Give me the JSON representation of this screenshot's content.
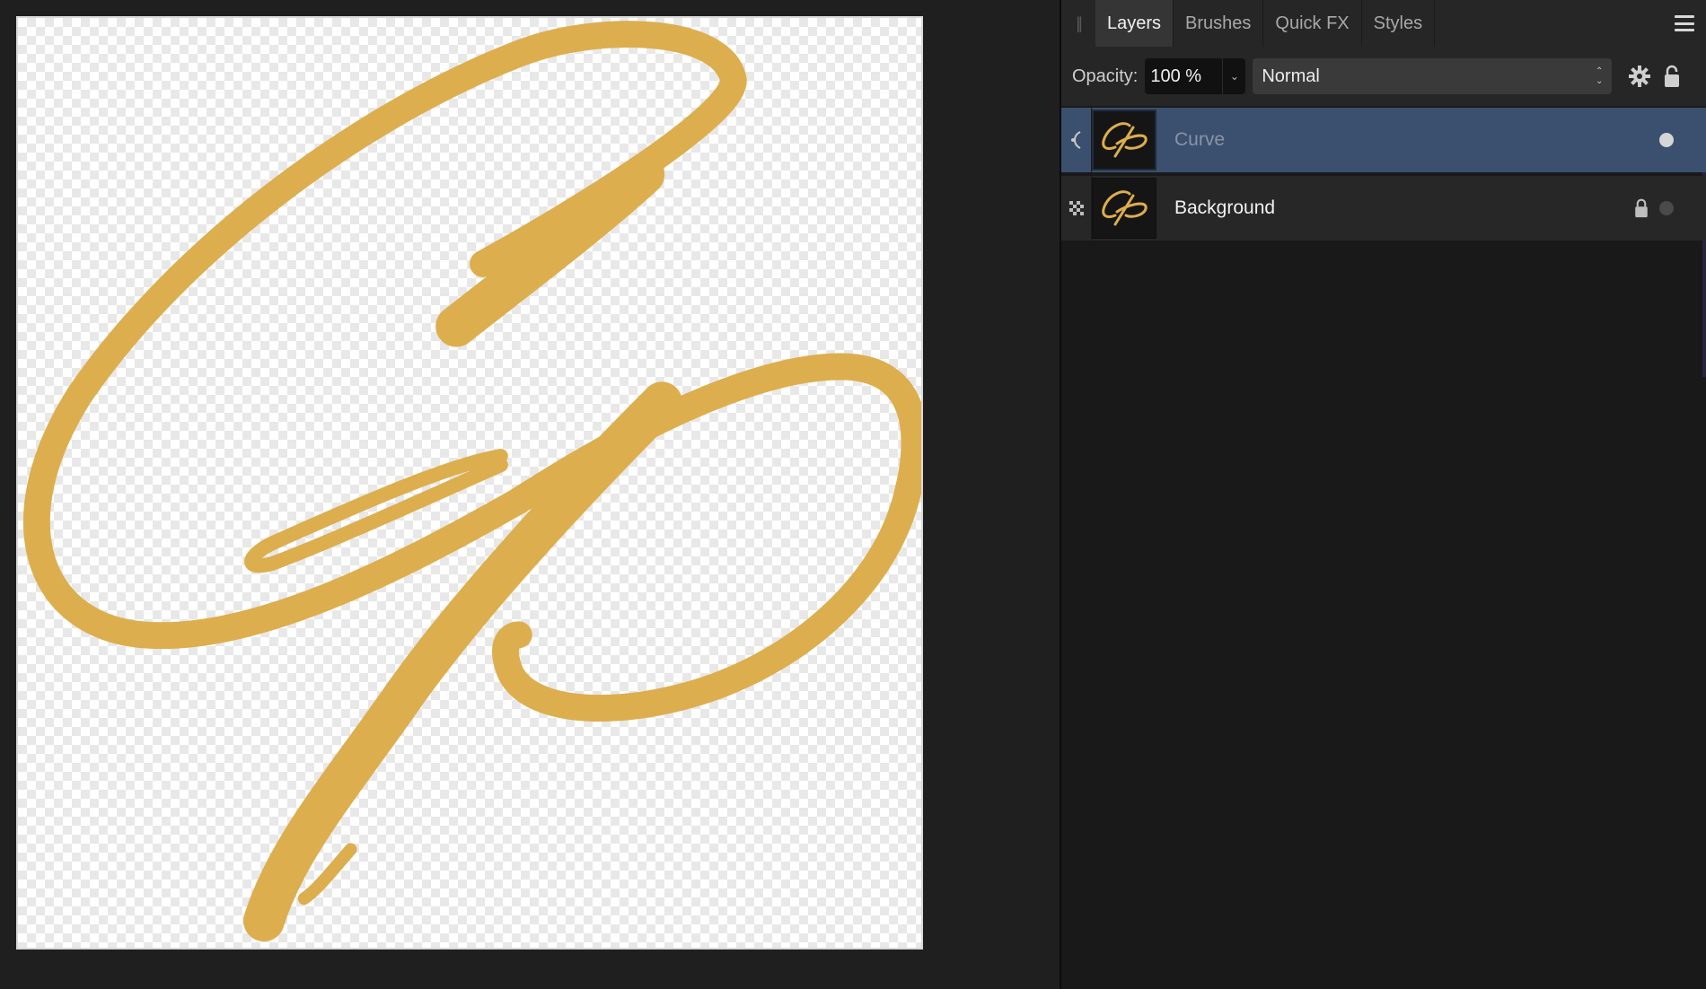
{
  "panel": {
    "tabs": [
      {
        "label": "Layers",
        "active": true
      },
      {
        "label": "Brushes",
        "active": false
      },
      {
        "label": "Quick FX",
        "active": false
      },
      {
        "label": "Styles",
        "active": false
      }
    ],
    "menu_icon": "hamburger-menu-icon"
  },
  "controls": {
    "opacity_label": "Opacity:",
    "opacity_value": "100 %",
    "blend_mode": "Normal",
    "settings_icon": "gear-icon",
    "lock_icon": "padlock-icon"
  },
  "layers": [
    {
      "name": "Curve",
      "type_icon": "curve-tool-icon",
      "selected": true,
      "locked": false,
      "visible": true
    },
    {
      "name": "Background",
      "type_icon": "pixel-layer-icon",
      "selected": false,
      "locked": true,
      "visible": true
    }
  ],
  "colors": {
    "artwork": "#DDAE4E",
    "selection": "#3B4F6E",
    "panel_bg": "#191919"
  }
}
